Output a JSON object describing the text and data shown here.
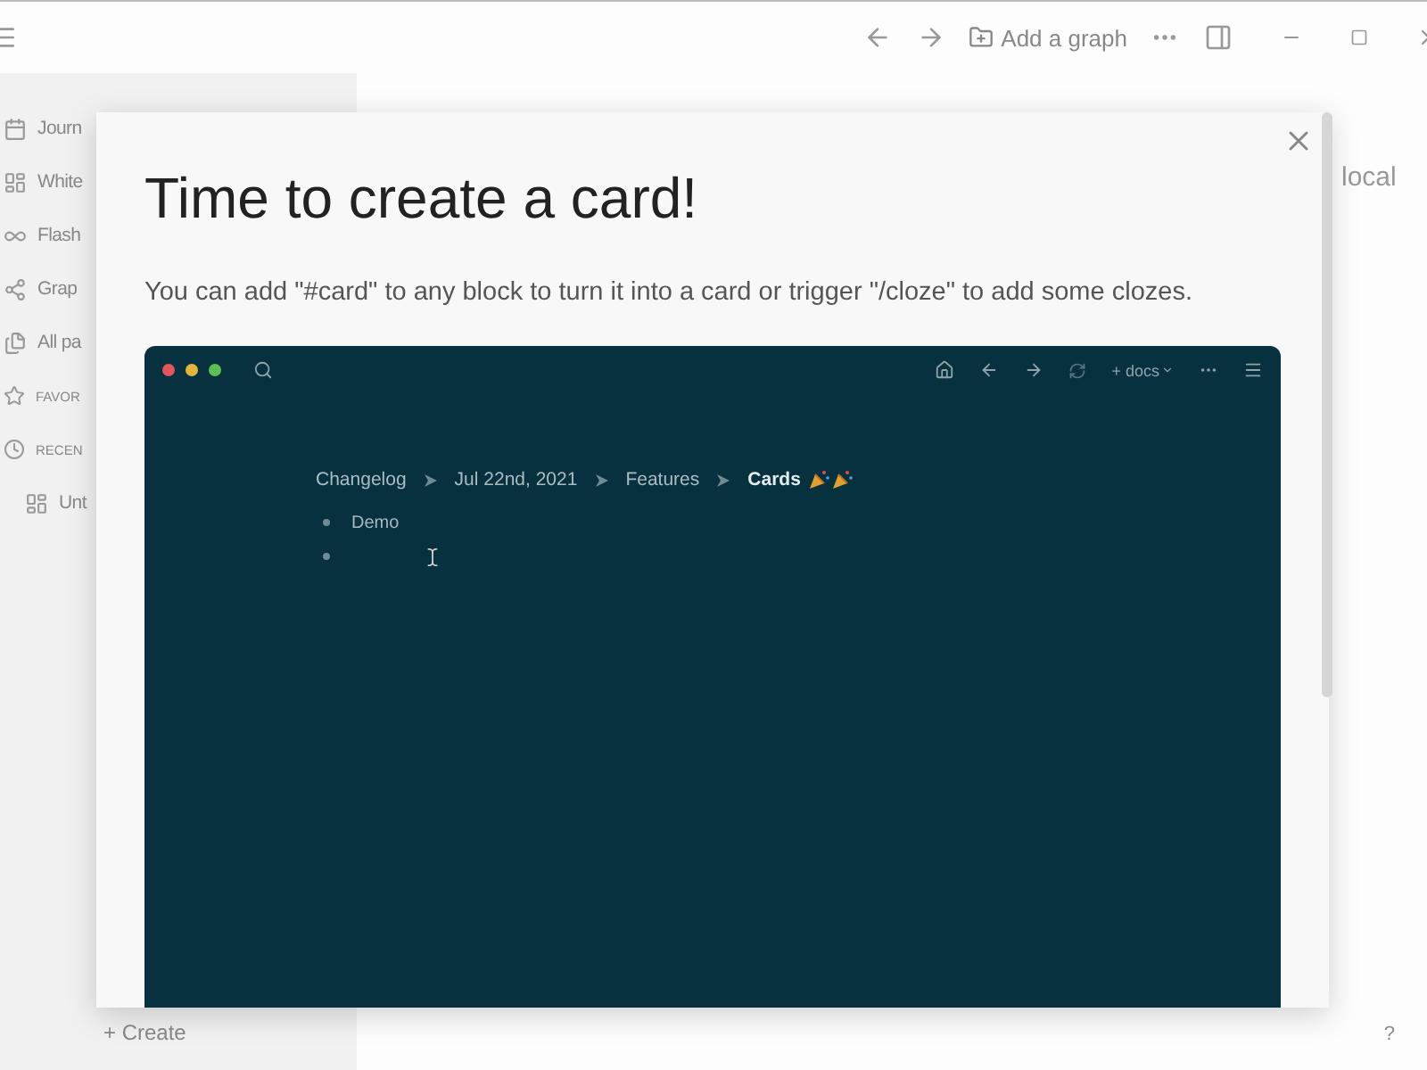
{
  "topbar": {
    "add_graph": "Add a graph"
  },
  "sidebar": {
    "items": [
      {
        "kind": "nav",
        "label": "Journ"
      },
      {
        "kind": "nav",
        "label": "White"
      },
      {
        "kind": "nav",
        "label": "Flash"
      },
      {
        "kind": "nav",
        "label": "Grap"
      },
      {
        "kind": "nav",
        "label": "All pa"
      },
      {
        "kind": "section",
        "label": "FAVOR"
      },
      {
        "kind": "section",
        "label": "RECEN"
      },
      {
        "kind": "page",
        "label": "Unt"
      }
    ],
    "create": "+ Create"
  },
  "background_text": "local",
  "help": "?",
  "dialog": {
    "title": "Time to create a card!",
    "description": "You can add \"#card\" to any block to turn it into a card or trigger \"/cloze\" to add some clozes.",
    "demo": {
      "new_page": "+ docs",
      "breadcrumbs": [
        {
          "label": "Changelog",
          "current": false
        },
        {
          "label": "Jul 22nd, 2021",
          "current": false
        },
        {
          "label": "Features",
          "current": false
        },
        {
          "label": "Cards",
          "current": true
        }
      ],
      "blocks": [
        {
          "kind": "text",
          "text": "Demo"
        },
        {
          "kind": "empty"
        }
      ]
    }
  }
}
